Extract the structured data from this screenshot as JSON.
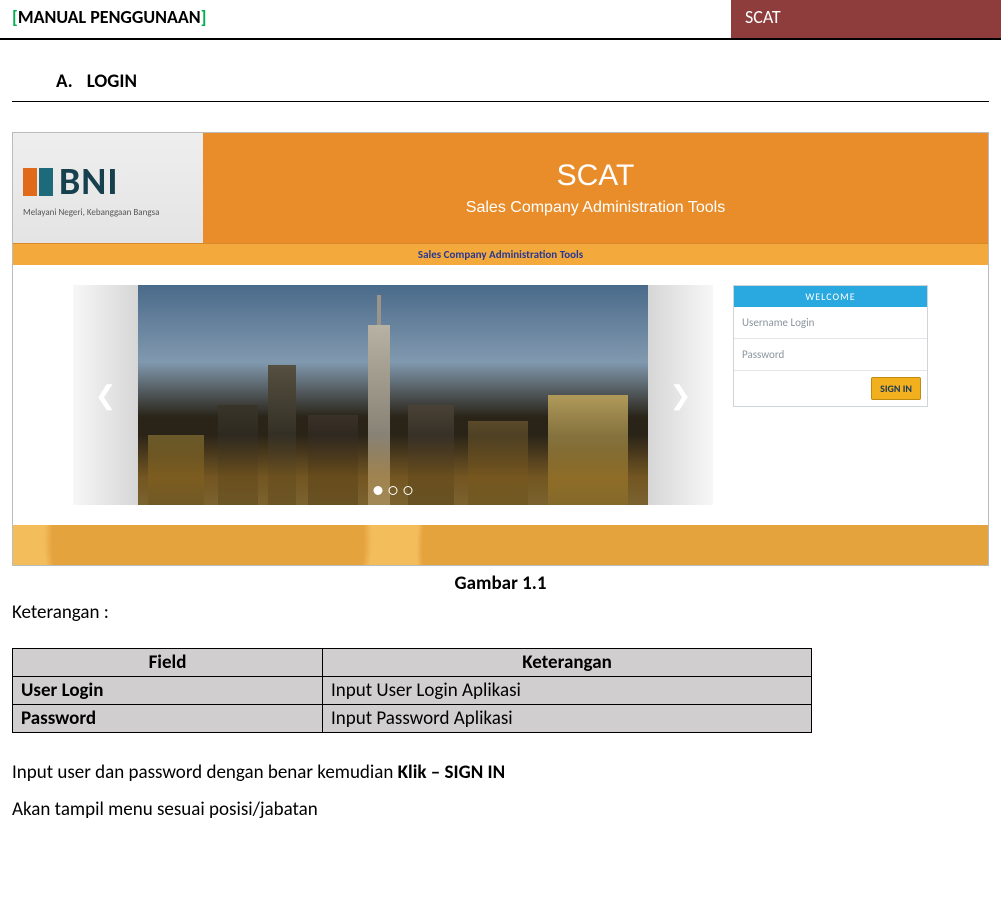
{
  "header": {
    "title": "MANUAL PENGGUNAAN",
    "tag": "SCAT"
  },
  "section": {
    "marker": "A.",
    "title": "LOGIN"
  },
  "screenshot": {
    "logo_text": "BNI",
    "logo_sub": "Melayani Negeri, Kebanggaan Bangsa",
    "banner_title": "SCAT",
    "banner_sub": "Sales Company Administration Tools",
    "subbar": "Sales Company Administration Tools",
    "login": {
      "welcome": "WELCOME",
      "username_ph": "Username Login",
      "password_ph": "Password",
      "signin": "SIGN IN"
    }
  },
  "caption": "Gambar 1.1",
  "keterangan_label": "Keterangan :",
  "table": {
    "head": [
      "Field",
      "Keterangan"
    ],
    "rows": [
      {
        "field": "User Login",
        "desc": "Input User Login Aplikasi"
      },
      {
        "field": "Password",
        "desc": "Input Password Aplikasi"
      }
    ]
  },
  "instruction": {
    "pre": "Input user dan password dengan benar kemudian ",
    "bold": "Klik – SIGN IN"
  },
  "note": "Akan tampil menu sesuai posisi/jabatan"
}
